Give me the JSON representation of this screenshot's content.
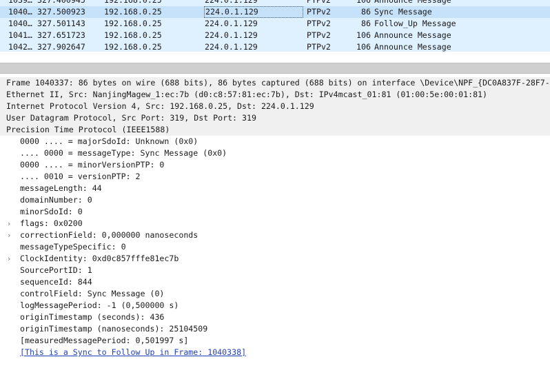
{
  "packet_list": {
    "rows": [
      {
        "no": "1039…",
        "time": "327.400945",
        "src": "192.168.0.25",
        "dst": "224.0.1.129",
        "proto": "PTPv2",
        "len": "106",
        "info": "Announce Message",
        "selected": false
      },
      {
        "no": "1040…",
        "time": "327.500923",
        "src": "192.168.0.25",
        "dst": "224.0.1.129",
        "proto": "PTPv2",
        "len": "86",
        "info": "Sync Message",
        "selected": true
      },
      {
        "no": "1040…",
        "time": "327.501143",
        "src": "192.168.0.25",
        "dst": "224.0.1.129",
        "proto": "PTPv2",
        "len": "86",
        "info": "Follow_Up Message",
        "selected": false
      },
      {
        "no": "1041…",
        "time": "327.651723",
        "src": "192.168.0.25",
        "dst": "224.0.1.129",
        "proto": "PTPv2",
        "len": "106",
        "info": "Announce Message",
        "selected": false
      },
      {
        "no": "1042…",
        "time": "327.902647",
        "src": "192.168.0.25",
        "dst": "224.0.1.129",
        "proto": "PTPv2",
        "len": "106",
        "info": "Announce Message",
        "selected": false
      }
    ]
  },
  "details": {
    "top": [
      "Frame 1040337: 86 bytes on wire (688 bits), 86 bytes captured (688 bits) on interface \\Device\\NPF_{DC0A837F-28F7-",
      "Ethernet II, Src: NanjingMagew_1:ec:7b (d0:c8:57:81:ec:7b), Dst: IPv4mcast_01:81 (01:00:5e:00:01:81)",
      "Internet Protocol Version 4, Src: 192.168.0.25, Dst: 224.0.1.129",
      "User Datagram Protocol, Src Port: 319, Dst Port: 319",
      "Precision Time Protocol (IEEE1588)"
    ],
    "ptp_fields": [
      {
        "text": "0000 .... = majorSdoId: Unknown (0x0)",
        "expandable": false
      },
      {
        "text": ".... 0000 = messageType: Sync Message (0x0)",
        "expandable": false
      },
      {
        "text": "0000 .... = minorVersionPTP: 0",
        "expandable": false
      },
      {
        "text": ".... 0010 = versionPTP: 2",
        "expandable": false
      },
      {
        "text": "messageLength: 44",
        "expandable": false
      },
      {
        "text": "domainNumber: 0",
        "expandable": false
      },
      {
        "text": "minorSdoId: 0",
        "expandable": false
      },
      {
        "text": "flags: 0x0200",
        "expandable": true
      },
      {
        "text": "correctionField: 0,000000 nanoseconds",
        "expandable": true
      },
      {
        "text": "messageTypeSpecific: 0",
        "expandable": false
      },
      {
        "text": "ClockIdentity: 0xd0c857fffe81ec7b",
        "expandable": true
      },
      {
        "text": "SourcePortID: 1",
        "expandable": false
      },
      {
        "text": "sequenceId: 844",
        "expandable": false
      },
      {
        "text": "controlField: Sync Message (0)",
        "expandable": false
      },
      {
        "text": "logMessagePeriod: -1 (0,500000 s)",
        "expandable": false
      },
      {
        "text": "originTimestamp (seconds): 436",
        "expandable": false
      },
      {
        "text": "originTimestamp (nanoseconds): 25104509",
        "expandable": false
      },
      {
        "text": "[measuredMessagePeriod: 0,501997 s]",
        "expandable": false
      }
    ],
    "link_text": "[This is a Sync to Follow Up in Frame: 1040338]",
    "expander_glyph": "›"
  }
}
